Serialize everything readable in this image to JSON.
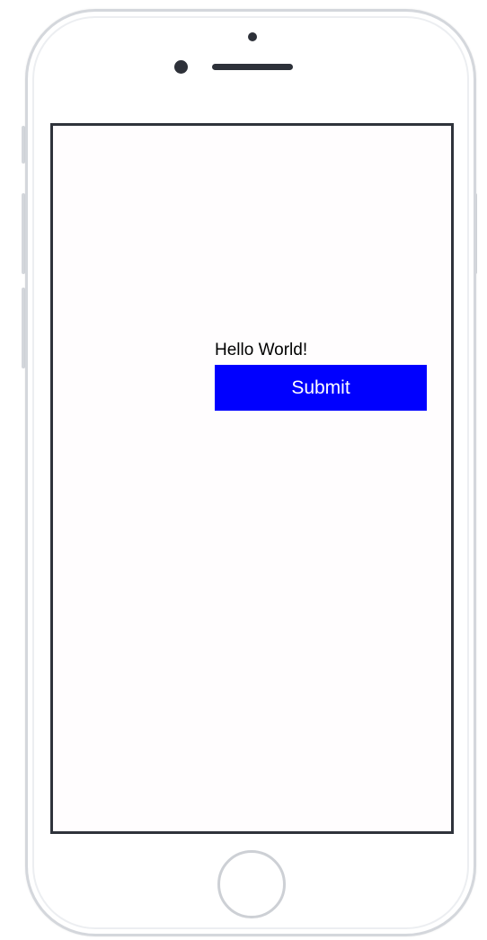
{
  "screen": {
    "greeting": "Hello World!",
    "submit_label": "Submit"
  },
  "colors": {
    "button_background": "#0000ff",
    "button_text": "#ffffff",
    "screen_background": "#fffdfe",
    "device_frame": "#d4d7dc"
  },
  "icons": {
    "home": "home-button-icon",
    "camera": "front-camera-icon",
    "speaker": "earpiece-speaker-icon"
  }
}
